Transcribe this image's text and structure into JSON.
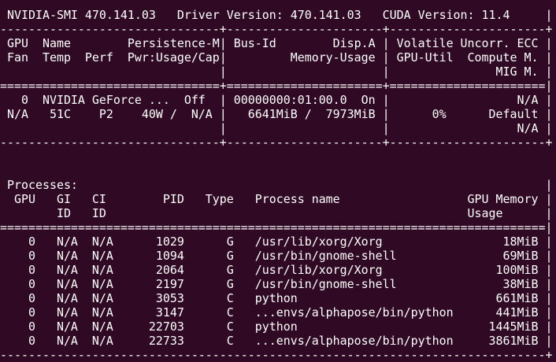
{
  "theme": {
    "background": "#300a24",
    "foreground": "#ffffff"
  },
  "terminal": {
    "lines": [
      " NVIDIA-SMI 470.141.03   Driver Version: 470.141.03   CUDA Version: 11.4     |",
      "-------------------------------+----------------------+----------------------+",
      " GPU  Name        Persistence-M| Bus-Id        Disp.A | Volatile Uncorr. ECC |",
      " Fan  Temp  Perf  Pwr:Usage/Cap|         Memory-Usage | GPU-Util  Compute M. |",
      "                               |                      |               MIG M. |",
      "===============================+======================+======================|",
      "   0  NVIDIA GeForce ...  Off  | 00000000:01:00.0  On |                  N/A |",
      " N/A   51C    P2    40W /  N/A |   6641MiB /  7973MiB |      0%      Default |",
      "                               |                      |                  N/A |",
      "-------------------------------+----------------------+----------------------+",
      "                                                                               ",
      "                                                                               ",
      " Processes:                                                                  |",
      "  GPU   GI   CI        PID   Type   Process name                  GPU Memory |",
      "        ID   ID                                                   Usage      |",
      "=============================================================================|",
      "    0   N/A  N/A      1029      G   /usr/lib/xorg/Xorg                 18MiB |",
      "    0   N/A  N/A      1094      G   /usr/bin/gnome-shell               69MiB |",
      "    0   N/A  N/A      2064      G   /usr/lib/xorg/Xorg                100MiB |",
      "    0   N/A  N/A      2197      G   /usr/bin/gnome-shell               38MiB |",
      "    0   N/A  N/A      3053      C   python                            661MiB |",
      "    0   N/A  N/A      3147      C   ...envs/alphapose/bin/python      441MiB |",
      "    0   N/A  N/A     22703      C   python                           1445MiB |",
      "    0   N/A  N/A     22733      C   ...envs/alphapose/bin/python     3861MiB |",
      "-----------------------------------------------------------------------------+"
    ]
  }
}
